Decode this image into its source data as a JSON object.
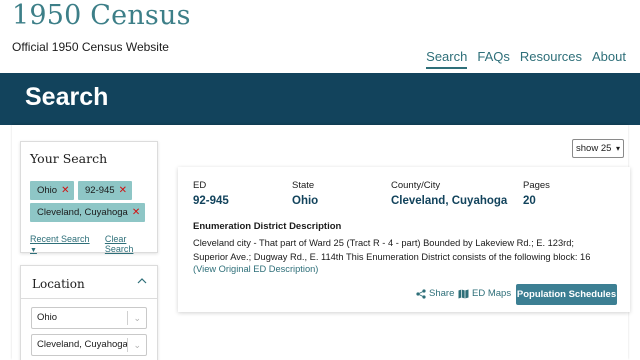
{
  "header": {
    "site_title": "1950 Census",
    "site_subtitle": "Official 1950 Census Website",
    "nav": [
      "Search",
      "FAQs",
      "Resources",
      "About"
    ],
    "active_nav": "Search"
  },
  "banner": {
    "title": "Search"
  },
  "your_search": {
    "heading": "Your Search",
    "chips": [
      "Ohio",
      "92-945",
      "Cleveland, Cuyahoga"
    ],
    "recent_search_label": "Recent Search",
    "clear_search_label": "Clear Search"
  },
  "location": {
    "heading": "Location",
    "selects": [
      "Ohio",
      "Cleveland, Cuyahoga"
    ]
  },
  "results_toolbar": {
    "show_value": "show 25"
  },
  "result": {
    "ed_label": "ED",
    "ed_value": "92-945",
    "state_label": "State",
    "state_value": "Ohio",
    "county_label": "County/City",
    "county_value": "Cleveland, Cuyahoga",
    "pages_label": "Pages",
    "pages_value": "20",
    "description_heading": "Enumeration District Description",
    "description_line1": "Cleveland city - That part of Ward 25 (Tract R - 4 - part) Bounded by Lakeview Rd.; E. 123rd;",
    "description_line2": "Superior Ave.; Dugway Rd., E. 114th This Enumeration District consists of the following block: 16",
    "view_original_link": "(View Original ED Description)",
    "share_label": "Share",
    "ed_maps_label": "ED Maps",
    "population_button": "Population Schedules"
  },
  "colors": {
    "brand_teal": "#3d7f88",
    "banner_navy": "#12435c",
    "chip_teal": "#8ec6c6",
    "button_blue": "#3c7f93",
    "remove_red": "#d10f0f"
  }
}
